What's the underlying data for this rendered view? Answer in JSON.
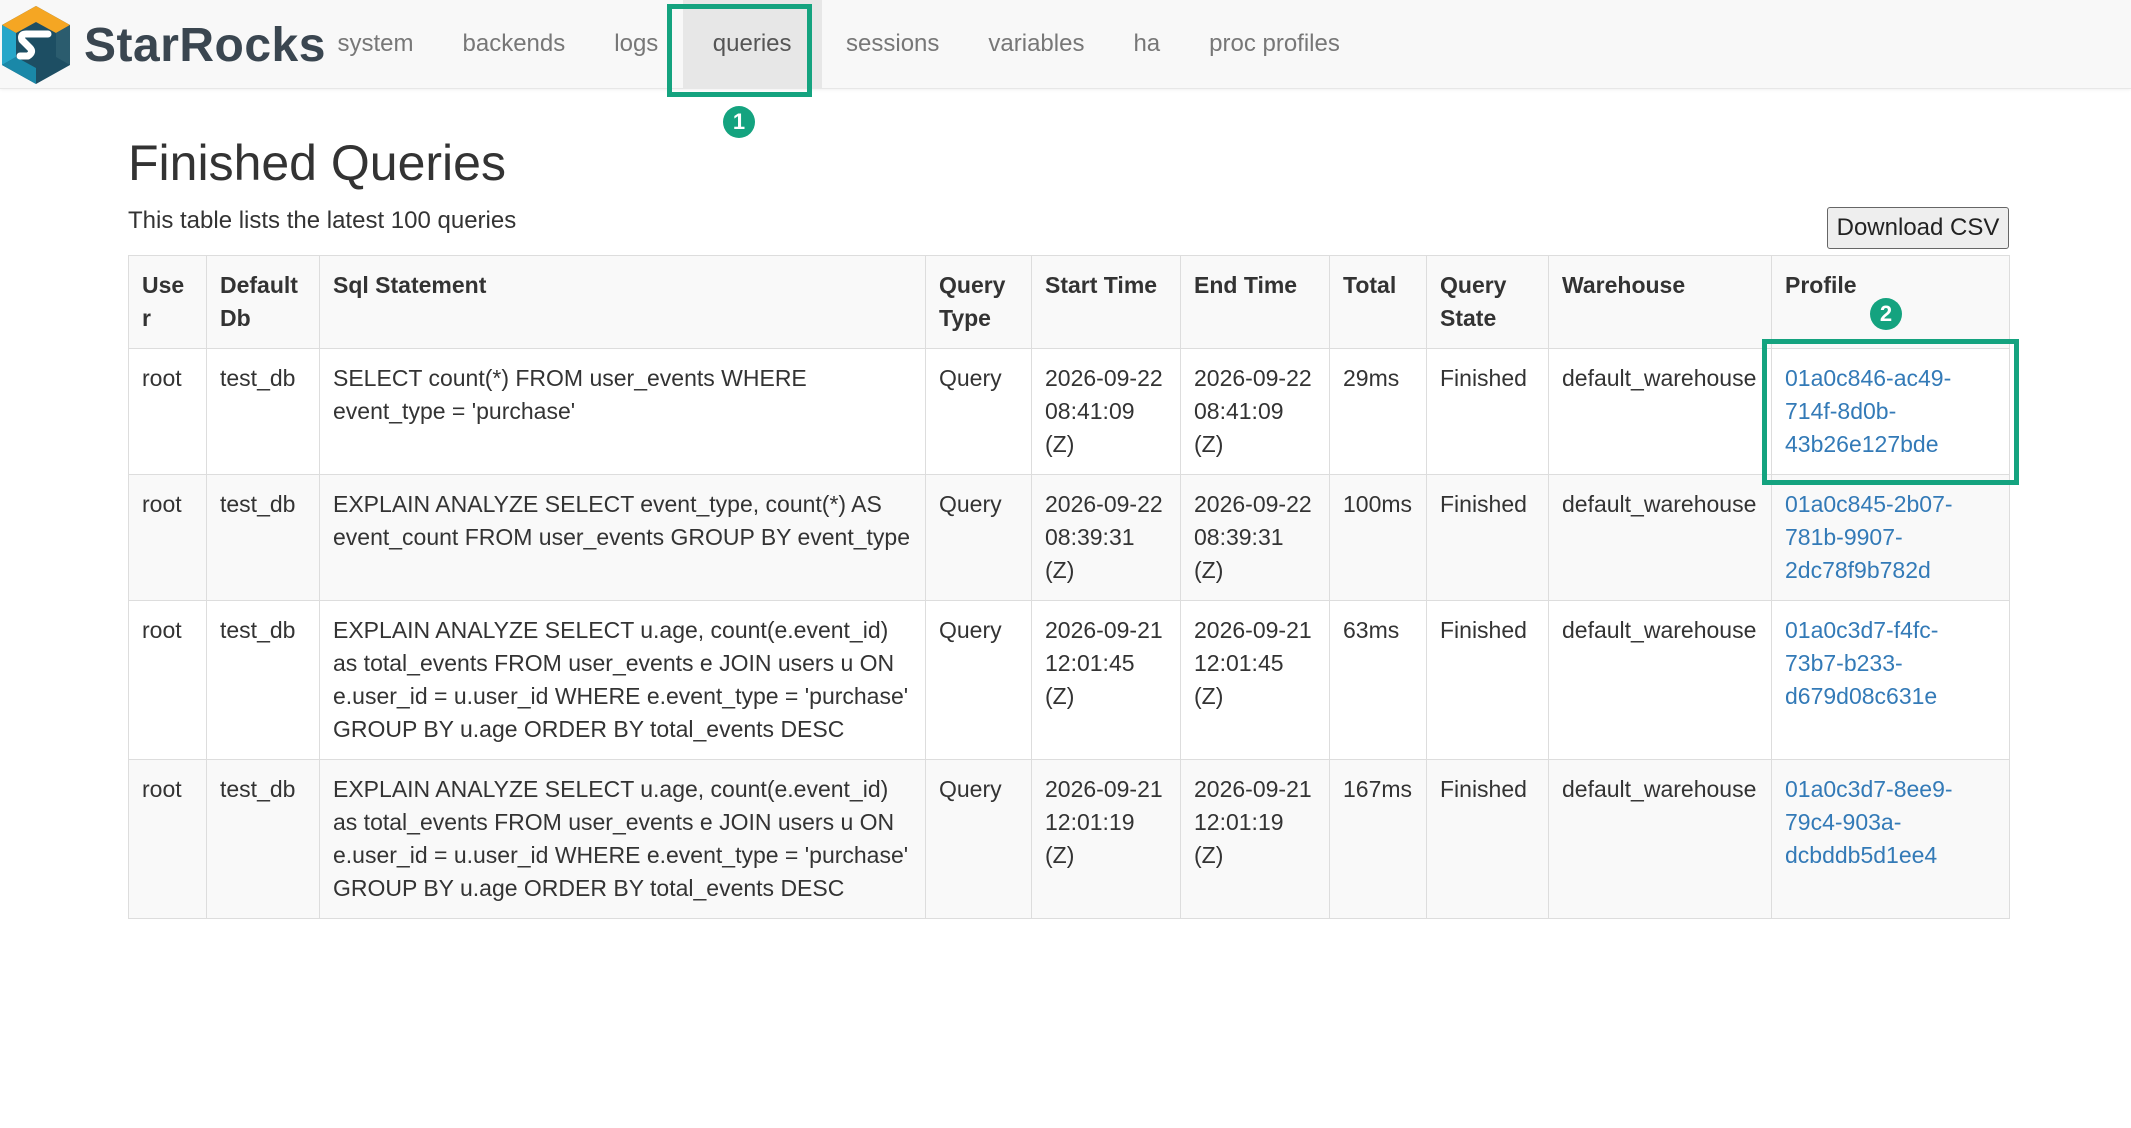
{
  "brand": {
    "name": "StarRocks",
    "logo_icon": "starrocks-logo-icon"
  },
  "nav": {
    "items": [
      {
        "label": "system"
      },
      {
        "label": "backends"
      },
      {
        "label": "logs"
      },
      {
        "label": "queries",
        "active": true
      },
      {
        "label": "sessions"
      },
      {
        "label": "variables"
      },
      {
        "label": "ha"
      },
      {
        "label": "proc profiles"
      }
    ]
  },
  "annotations": {
    "marker1": "1",
    "marker2": "2",
    "color": "#14a37f"
  },
  "page": {
    "title": "Finished Queries",
    "subtitle": "This table lists the latest 100 queries",
    "download_csv_label": "Download CSV"
  },
  "table": {
    "columns": [
      "User",
      "Default Db",
      "Sql Statement",
      "Query Type",
      "Start Time",
      "End Time",
      "Total",
      "Query State",
      "Warehouse",
      "Profile"
    ],
    "rows": [
      {
        "user": "root",
        "db": "test_db",
        "sql": "SELECT count(*) FROM user_events WHERE event_type = 'purchase'",
        "type": "Query",
        "start": "2026-09-22 08:41:09 (Z)",
        "end": "2026-09-22 08:41:09 (Z)",
        "total": "29ms",
        "state": "Finished",
        "warehouse": "default_warehouse",
        "profile": "01a0c846-ac49-714f-8d0b-43b26e127bde"
      },
      {
        "user": "root",
        "db": "test_db",
        "sql": "EXPLAIN ANALYZE SELECT event_type, count(*) AS event_count FROM user_events GROUP BY event_type",
        "type": "Query",
        "start": "2026-09-22 08:39:31 (Z)",
        "end": "2026-09-22 08:39:31 (Z)",
        "total": "100ms",
        "state": "Finished",
        "warehouse": "default_warehouse",
        "profile": "01a0c845-2b07-781b-9907-2dc78f9b782d"
      },
      {
        "user": "root",
        "db": "test_db",
        "sql": "EXPLAIN ANALYZE SELECT u.age, count(e.event_id) as total_events FROM user_events e JOIN users u ON e.user_id = u.user_id WHERE e.event_type = 'purchase' GROUP BY u.age ORDER BY total_events DESC",
        "type": "Query",
        "start": "2026-09-21 12:01:45 (Z)",
        "end": "2026-09-21 12:01:45 (Z)",
        "total": "63ms",
        "state": "Finished",
        "warehouse": "default_warehouse",
        "profile": "01a0c3d7-f4fc-73b7-b233-d679d08c631e"
      },
      {
        "user": "root",
        "db": "test_db",
        "sql": "EXPLAIN ANALYZE SELECT u.age, count(e.event_id) as total_events FROM user_events e JOIN users u ON e.user_id = u.user_id WHERE e.event_type = 'purchase' GROUP BY u.age ORDER BY total_events DESC",
        "type": "Query",
        "start": "2026-09-21 12:01:19 (Z)",
        "end": "2026-09-21 12:01:19 (Z)",
        "total": "167ms",
        "state": "Finished",
        "warehouse": "default_warehouse",
        "profile": "01a0c3d7-8ee9-79c4-903a-dcbddb5d1ee4"
      }
    ]
  }
}
